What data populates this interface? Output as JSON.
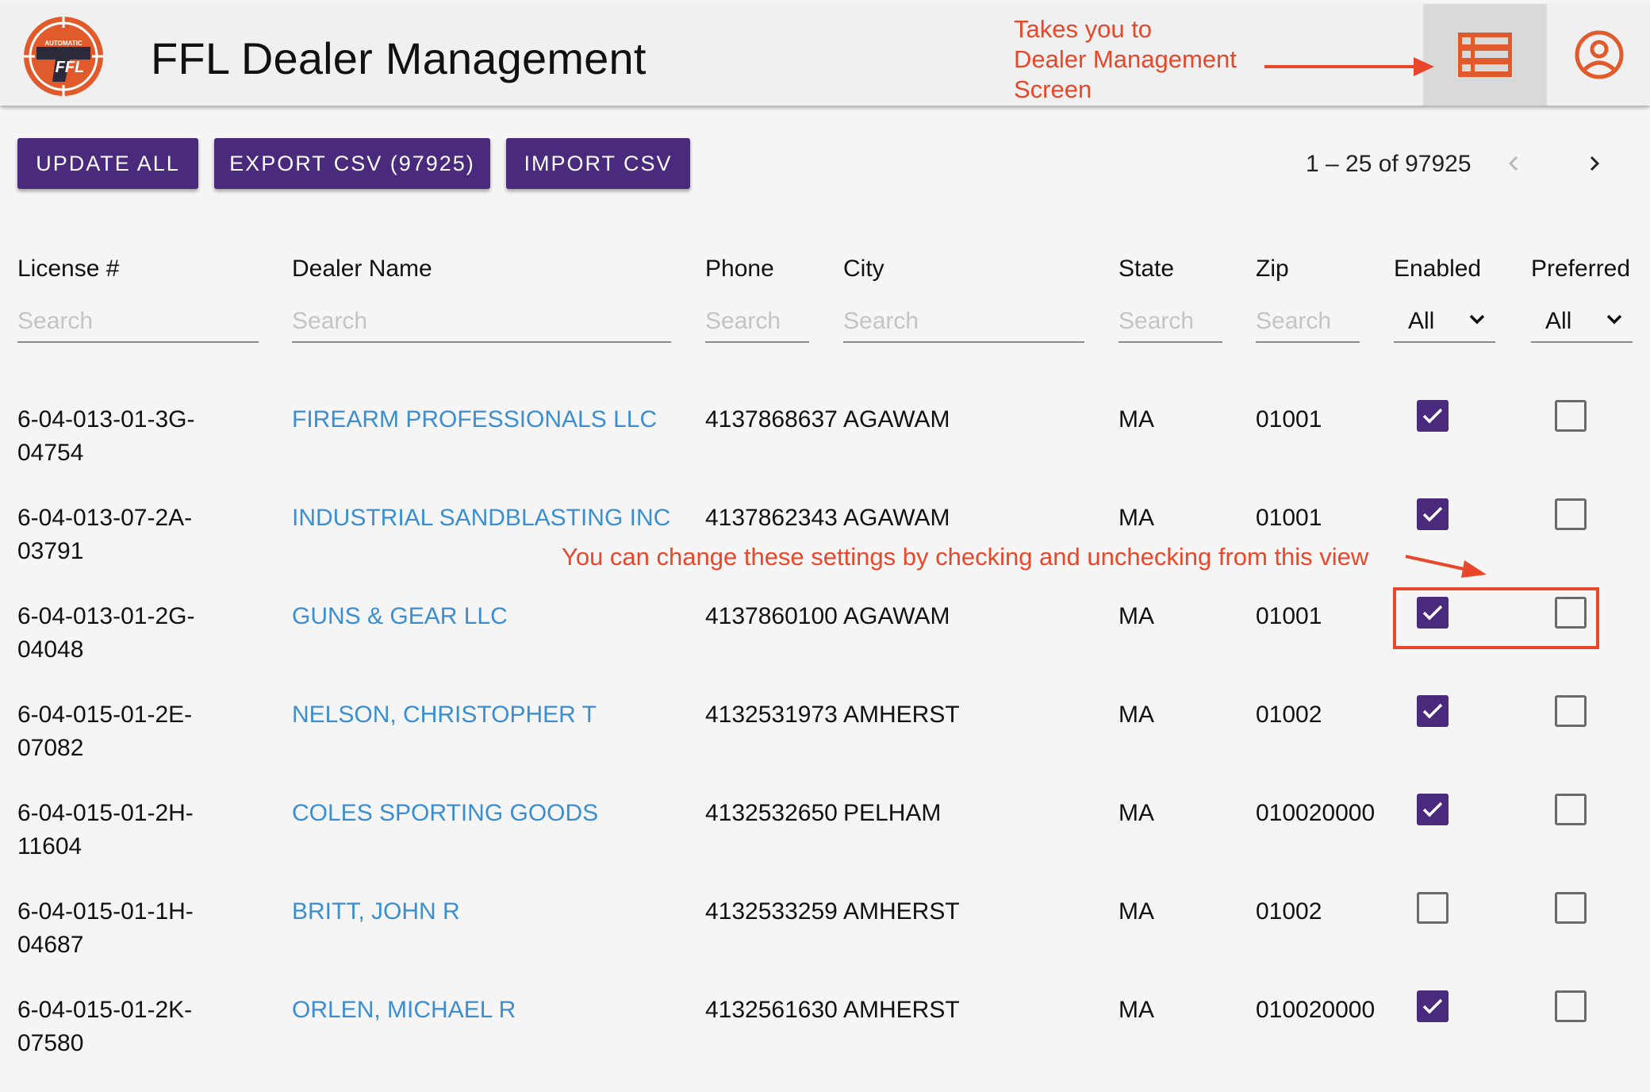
{
  "app": {
    "title": "FFL Dealer Management",
    "logo_text_top": "AUTOMATIC",
    "logo_text_main": "FFL",
    "accent": "#4a2a7c",
    "link_color": "#3b8fd0",
    "logo_color": "#e05a2b",
    "annotation_color": "#e8472a"
  },
  "annotations": {
    "top_lines": [
      "Takes you to",
      "Dealer Management",
      "Screen"
    ],
    "middle": "You can change these settings by checking and unchecking from this view"
  },
  "icons": {
    "dealer_management": "list-icon",
    "account": "account-circle-icon",
    "prev": "chevron-left-icon",
    "next": "chevron-right-icon",
    "dropdown": "chevron-down-icon",
    "check": "check-icon"
  },
  "toolbar": {
    "update_all": "UPDATE ALL",
    "export_csv": "EXPORT CSV (97925)",
    "import_csv": "IMPORT CSV"
  },
  "paginator": {
    "label": "1 – 25 of 97925"
  },
  "columns": {
    "license": "License #",
    "dealer_name": "Dealer Name",
    "phone": "Phone",
    "city": "City",
    "state": "State",
    "zip": "Zip",
    "enabled": "Enabled",
    "preferred": "Preferred"
  },
  "filters": {
    "search_placeholder": "Search",
    "enabled_value": "All",
    "preferred_value": "All"
  },
  "rows": [
    {
      "license_line1": "6-04-013-01-3G-",
      "license_line2": "04754",
      "name": "FIREARM PROFESSIONALS LLC",
      "phone": "4137868637",
      "city": "AGAWAM",
      "state": "MA",
      "zip": "01001",
      "enabled": true,
      "preferred": false
    },
    {
      "license_line1": "6-04-013-07-2A-",
      "license_line2": "03791",
      "name": "INDUSTRIAL SANDBLASTING INC",
      "phone": "4137862343",
      "city": "AGAWAM",
      "state": "MA",
      "zip": "01001",
      "enabled": true,
      "preferred": false
    },
    {
      "license_line1": "6-04-013-01-2G-",
      "license_line2": "04048",
      "name": "GUNS & GEAR LLC",
      "phone": "4137860100",
      "city": "AGAWAM",
      "state": "MA",
      "zip": "01001",
      "enabled": true,
      "preferred": false
    },
    {
      "license_line1": "6-04-015-01-2E-",
      "license_line2": "07082",
      "name": "NELSON, CHRISTOPHER T",
      "phone": "4132531973",
      "city": "AMHERST",
      "state": "MA",
      "zip": "01002",
      "enabled": true,
      "preferred": false
    },
    {
      "license_line1": "6-04-015-01-2H-",
      "license_line2": "11604",
      "name": "COLES SPORTING GOODS",
      "phone": "4132532650",
      "city": "PELHAM",
      "state": "MA",
      "zip": "010020000",
      "enabled": true,
      "preferred": false
    },
    {
      "license_line1": "6-04-015-01-1H-",
      "license_line2": "04687",
      "name": "BRITT, JOHN R",
      "phone": "4132533259",
      "city": "AMHERST",
      "state": "MA",
      "zip": "01002",
      "enabled": false,
      "preferred": false
    },
    {
      "license_line1": "6-04-015-01-2K-",
      "license_line2": "07580",
      "name": "ORLEN, MICHAEL R",
      "phone": "4132561630",
      "city": "AMHERST",
      "state": "MA",
      "zip": "010020000",
      "enabled": true,
      "preferred": false
    }
  ]
}
